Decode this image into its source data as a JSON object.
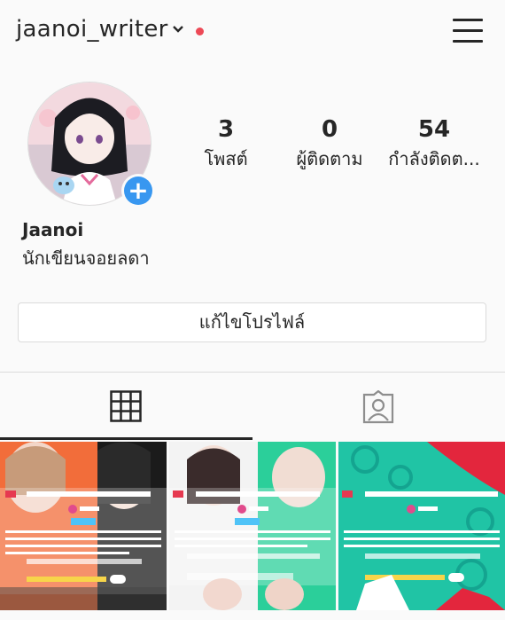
{
  "header": {
    "username": "jaanoi_writer",
    "icons": [
      "chevron-down-icon",
      "notification-dot",
      "hamburger-menu-icon"
    ],
    "accent_dot_color": "#ed4956"
  },
  "profile": {
    "name": "Jaanoi",
    "bio": "นักเขียนจอยลดา",
    "add_story_color": "#3897f0"
  },
  "stats": [
    {
      "value": "3",
      "label": "โพสต์"
    },
    {
      "value": "0",
      "label": "ผู้ติดตาม"
    },
    {
      "value": "54",
      "label": "กำลังติดต..."
    }
  ],
  "edit_profile_label": "แก้ไขโปรไฟล์",
  "tabs": [
    {
      "icon": "grid-icon",
      "active": true
    },
    {
      "icon": "tagged-person-icon",
      "active": false
    }
  ],
  "posts": [
    {
      "title": "[END]ผู้หญิง? ผู้ไง❤️เลิฟ~เมโลดี้ ศรีรักSS2",
      "author": "Jaanoi",
      "colors": [
        "#f26d3a",
        "#1b1b1b",
        "#ffffff"
      ]
    },
    {
      "title": "[END]วิกตม ยันคู่หมั้น❤️ธรง~รักอยู่ แต่รู้ไม่ต้องเกรย2",
      "author": "Jaanoi",
      "colors": [
        "#ef3fa8",
        "#2bcf9a",
        "#ffffff"
      ]
    },
    {
      "title": "[END]เราเป็นไงกันSS1~ต่างคนใจดีSS2",
      "author": "Jaanoi",
      "colors": [
        "#20c4a5",
        "#e3263d",
        "#ffffff"
      ]
    }
  ]
}
